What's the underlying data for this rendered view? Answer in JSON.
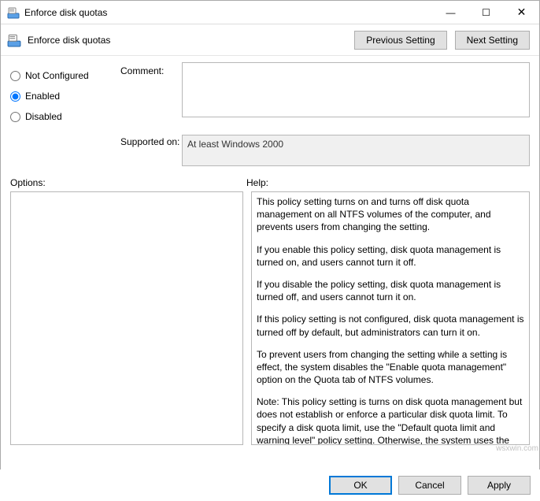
{
  "window": {
    "title": "Enforce disk quotas",
    "minimize_icon": "—",
    "maximize_icon": "☐",
    "close_icon": "✕"
  },
  "header": {
    "policy_name": "Enforce disk quotas",
    "prev_setting_label": "Previous Setting",
    "next_setting_label": "Next Setting"
  },
  "state": {
    "not_configured_label": "Not Configured",
    "enabled_label": "Enabled",
    "disabled_label": "Disabled",
    "selected": "enabled"
  },
  "labels": {
    "comment": "Comment:",
    "supported_on": "Supported on:",
    "options": "Options:",
    "help": "Help:"
  },
  "comment_value": "",
  "supported_on_value": "At least Windows 2000",
  "help_text": {
    "p1": "This policy setting turns on and turns off disk quota management on all NTFS volumes of the computer, and prevents users from changing the setting.",
    "p2": "If you enable this policy setting, disk quota management is turned on, and users cannot turn it off.",
    "p3": "If you disable the policy setting, disk quota management is turned off, and users cannot turn it on.",
    "p4": "If this policy setting is not configured, disk quota management is turned  off by default, but administrators can turn it on.",
    "p5": "To prevent users from changing the setting while a setting is effect, the system disables the \"Enable quota management\" option on the Quota tab of NTFS volumes.",
    "p6": "Note: This policy setting is turns on disk quota management but does not establish or enforce a particular disk quota limit. To specify a disk quota limit, use the \"Default quota limit and warning level\" policy setting. Otherwise, the system uses the physical space on the volume as the quota limit."
  },
  "footer": {
    "ok_label": "OK",
    "cancel_label": "Cancel",
    "apply_label": "Apply"
  },
  "watermark": "wsxwin.com"
}
